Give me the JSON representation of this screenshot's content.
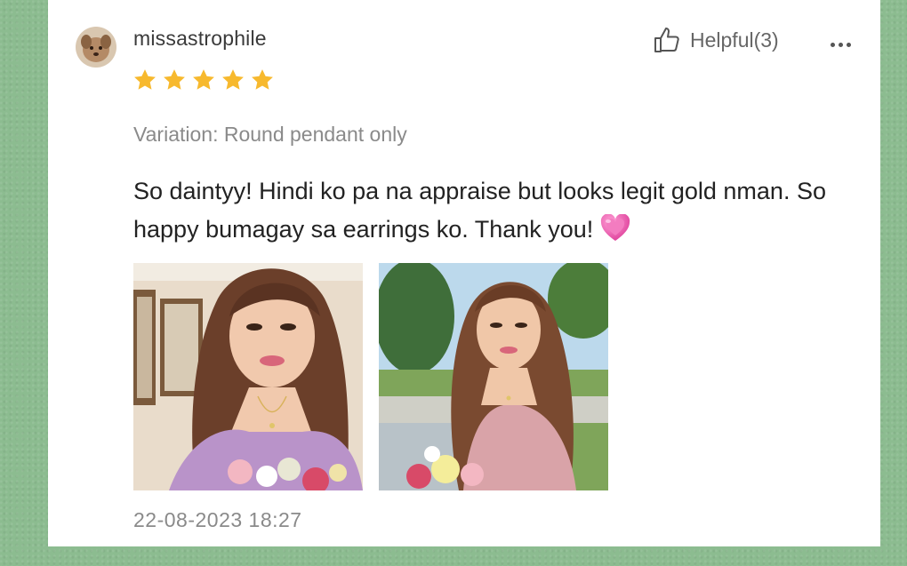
{
  "review": {
    "username": "missastrophile",
    "rating": 5,
    "rating_max": 5,
    "helpful_label": "Helpful(3)",
    "variation": "Variation: Round pendant only",
    "text": "So daintyy! Hindi ko pa na appraise but looks legit gold nman. So happy bumagay sa earrings ko. Thank you!",
    "timestamp": "22-08-2023 18:27",
    "photos": [
      {
        "icon": "review-photo-1"
      },
      {
        "icon": "review-photo-2"
      }
    ]
  },
  "colors": {
    "background": "#8cbc90",
    "card": "#ffffff",
    "star": "#f7b92e",
    "heart": "#f06ab8",
    "muted_text": "#8a8a8a"
  },
  "icons": {
    "thumb": "thumbs-up-icon",
    "more": "more-icon",
    "heart": "pink-heart-emoji-icon",
    "star": "star-icon"
  }
}
